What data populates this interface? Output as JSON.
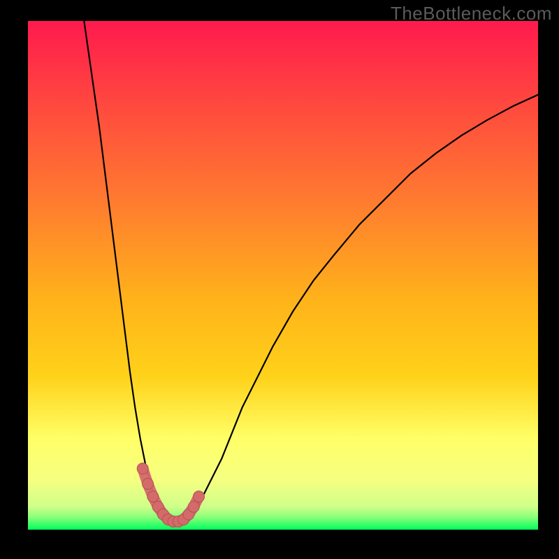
{
  "watermark": "TheBottleneck.com",
  "colors": {
    "frame": "#000000",
    "watermark_text": "#5b5b5b",
    "gradient_top": "#ff1a4e",
    "gradient_mid_upper": "#ff7a30",
    "gradient_mid": "#ffd21a",
    "gradient_mid_lower": "#f6ff80",
    "gradient_bottom": "#00ff5e",
    "curve": "#000000",
    "marker_fill": "#d46a6a",
    "marker_stroke": "#b45252"
  },
  "chart_data": {
    "type": "line",
    "title": "",
    "xlabel": "",
    "ylabel": "",
    "xlim": [
      0,
      100
    ],
    "ylim": [
      0,
      100
    ],
    "series": [
      {
        "name": "curve",
        "x": [
          11,
          12,
          13,
          14,
          15,
          16,
          17,
          18,
          19,
          20,
          21,
          22,
          23,
          24,
          25,
          26,
          27,
          28,
          29,
          30,
          31,
          32,
          33,
          34,
          36,
          38,
          40,
          42,
          45,
          48,
          52,
          56,
          60,
          65,
          70,
          75,
          80,
          85,
          90,
          95,
          100
        ],
        "values": [
          100,
          93,
          86,
          79,
          71,
          63,
          55,
          47,
          39,
          31,
          24,
          18,
          13,
          9,
          6,
          4,
          2.5,
          1.8,
          1.5,
          1.5,
          1.8,
          2.5,
          4,
          6,
          10,
          14,
          19,
          24,
          30,
          36,
          43,
          49,
          54,
          60,
          65,
          70,
          74,
          77.5,
          80.5,
          83.2,
          85.5
        ]
      }
    ],
    "markers": {
      "name": "highlighted-region",
      "x": [
        22.5,
        23.5,
        24.5,
        25.5,
        26.5,
        27.5,
        28.5,
        29.5,
        30.5,
        31.5,
        32.5,
        33.5
      ],
      "values": [
        12,
        9,
        6.5,
        4.5,
        3,
        2,
        1.6,
        1.6,
        2,
        3,
        4.5,
        6.5
      ]
    }
  }
}
